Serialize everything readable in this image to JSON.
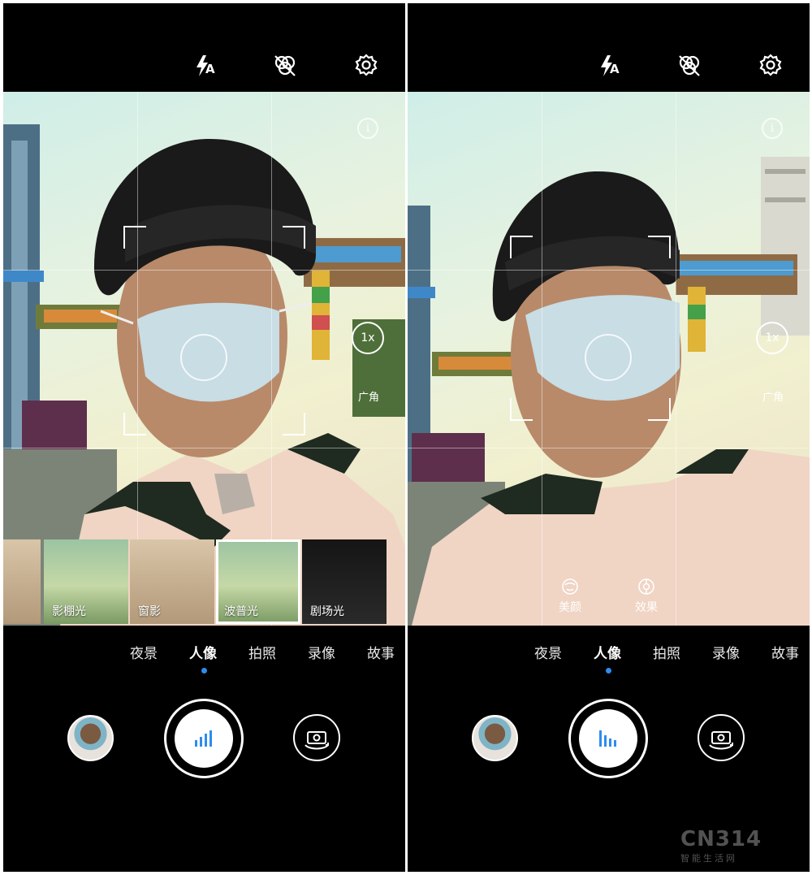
{
  "screens": [
    {
      "top_icons": [
        "flash-auto-icon",
        "filter-off-icon",
        "settings-gear-icon"
      ],
      "flash_text": "A",
      "zoom": "1x",
      "lens_label": "广角",
      "filters": [
        "影棚光",
        "窗影",
        "波普光",
        "剧场光"
      ],
      "selected_filter": "波普光",
      "modes": [
        "夜景",
        "人像",
        "拍照",
        "录像",
        "故事"
      ],
      "active_mode": "人像"
    },
    {
      "top_icons": [
        "flash-auto-icon",
        "filter-off-icon",
        "settings-gear-icon"
      ],
      "flash_text": "A",
      "zoom": "1x",
      "lens_label": "广角",
      "effects": [
        "美颜",
        "效果"
      ],
      "modes": [
        "夜景",
        "人像",
        "拍照",
        "录像",
        "故事"
      ],
      "active_mode": "人像"
    }
  ],
  "watermark": {
    "brand": "CN314",
    "tagline": "智能生活网"
  },
  "colors": {
    "accent": "#2d8cf0",
    "background": "#000000",
    "foreground": "#ffffff"
  }
}
